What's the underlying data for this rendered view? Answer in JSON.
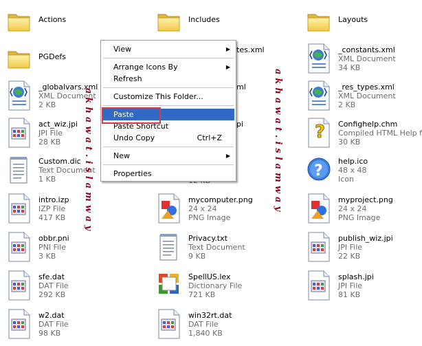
{
  "files": [
    {
      "name": "Actions",
      "type": "",
      "size": ""
    },
    {
      "name": "Includes",
      "type": "",
      "size": ""
    },
    {
      "name": "Layouts",
      "type": "",
      "size": ""
    },
    {
      "name": "PGDefs",
      "type": "",
      "size": ""
    },
    {
      "name": "tes.xml",
      "type": "",
      "size": ""
    },
    {
      "name": "_constants.xml",
      "type": "XML Document",
      "size": "34 KB"
    },
    {
      "name": "_globalvars.xml",
      "type": "XML Document",
      "size": "2 KB"
    },
    {
      "name": "ml",
      "type": "",
      "size": ""
    },
    {
      "name": "_res_types.xml",
      "type": "XML Document",
      "size": "2 KB"
    },
    {
      "name": "act_wiz.jpi",
      "type": "JPI File",
      "size": "28 KB"
    },
    {
      "name": "pi",
      "type": "",
      "size": ""
    },
    {
      "name": "Confighelp.chm",
      "type": "Compiled HTML Help file",
      "size": "30 KB"
    },
    {
      "name": "Custom.dic",
      "type": "Text Document",
      "size": "1 KB"
    },
    {
      "name": "12 KB",
      "type": "",
      "size": ""
    },
    {
      "name": "help.ico",
      "type": "48 x 48",
      "size": "Icon"
    },
    {
      "name": "intro.izp",
      "type": "IZP File",
      "size": "417 KB"
    },
    {
      "name": "mycomputer.png",
      "type": "24 x 24",
      "size": "PNG Image"
    },
    {
      "name": "myproject.png",
      "type": "24 x 24",
      "size": "PNG Image"
    },
    {
      "name": "obbr.pni",
      "type": "PNI File",
      "size": "3 KB"
    },
    {
      "name": "Privacy.txt",
      "type": "Text Document",
      "size": "9 KB"
    },
    {
      "name": "publish_wiz.jpi",
      "type": "JPI File",
      "size": "22 KB"
    },
    {
      "name": "sfe.dat",
      "type": "DAT File",
      "size": "292 KB"
    },
    {
      "name": "SpellUS.lex",
      "type": "Dictionary File",
      "size": "721 KB"
    },
    {
      "name": "splash.jpi",
      "type": "JPI File",
      "size": "81 KB"
    },
    {
      "name": "w2.dat",
      "type": "DAT File",
      "size": "98 KB"
    },
    {
      "name": "win32rt.dat",
      "type": "DAT File",
      "size": "1,840 KB"
    }
  ],
  "menu": {
    "view": "View",
    "arrange": "Arrange Icons By",
    "refresh": "Refresh",
    "customize": "Customize This Folder...",
    "paste": "Paste",
    "paste_shortcut": "Paste Shortcut",
    "undo": "Undo Copy",
    "undo_key": "Ctrl+Z",
    "new": "New",
    "properties": "Properties"
  },
  "watermark": "akhawat.islamway",
  "colors": {
    "selection": "#316ac5",
    "highlight_box": "#e0383a",
    "watermark": "#a00018"
  }
}
